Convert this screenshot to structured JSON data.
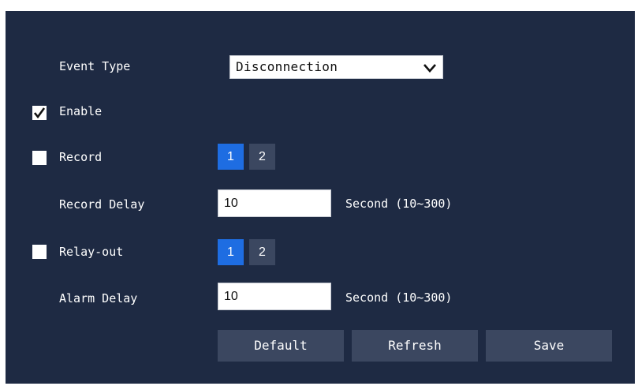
{
  "event_type": {
    "label": "Event Type",
    "selected": "Disconnection",
    "dropdown_icon": "chevron-down-icon"
  },
  "enable": {
    "label": "Enable",
    "checked": true
  },
  "record": {
    "label": "Record",
    "checked": false,
    "channels": [
      "1",
      "2"
    ],
    "active_channel": "1"
  },
  "record_delay": {
    "label": "Record Delay",
    "value": "10",
    "hint": "Second (10~300)"
  },
  "relay_out": {
    "label": "Relay-out",
    "checked": false,
    "channels": [
      "1",
      "2"
    ],
    "active_channel": "1"
  },
  "alarm_delay": {
    "label": "Alarm Delay",
    "value": "10",
    "hint": "Second (10~300)"
  },
  "buttons": {
    "default": "Default",
    "refresh": "Refresh",
    "save": "Save"
  },
  "colors": {
    "panel_bg": "#1e2a43",
    "active_channel": "#1e6de2",
    "button_bg": "#3b4760"
  }
}
